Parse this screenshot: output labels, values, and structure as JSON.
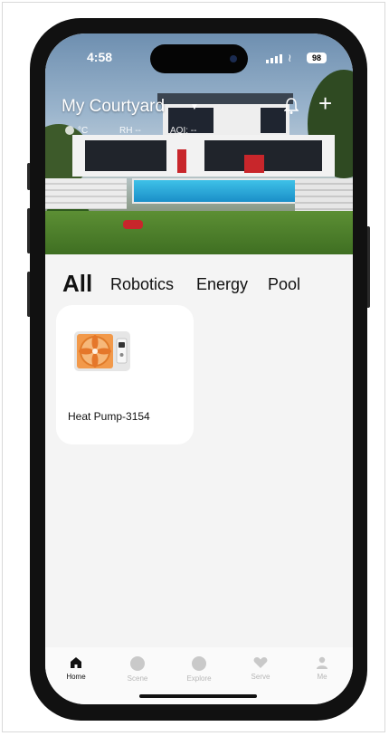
{
  "status_bar": {
    "time": "4:58",
    "battery": "98"
  },
  "header": {
    "home_name": "My Courtyard",
    "env_temp": "°C",
    "env_rh": "RH --",
    "env_aqi": "AQI: --"
  },
  "categories": {
    "active": "All",
    "items": [
      "All",
      "Robotics",
      "Energy",
      "Pool"
    ]
  },
  "devices": [
    {
      "name": "Heat Pump-3154",
      "icon": "heat-pump-icon"
    }
  ],
  "tab_bar": {
    "items": [
      {
        "label": "Home",
        "icon": "home-icon",
        "active": true
      },
      {
        "label": "Scene",
        "icon": "scene-icon",
        "active": false
      },
      {
        "label": "Explore",
        "icon": "explore-icon",
        "active": false
      },
      {
        "label": "Serve",
        "icon": "heart-icon",
        "active": false
      },
      {
        "label": "Me",
        "icon": "person-icon",
        "active": false
      }
    ]
  },
  "colors": {
    "accent": "#111111",
    "background": "#f4f4f4",
    "card": "#ffffff",
    "inactive": "#b7b7b7",
    "heat_pump_fan": "#f2994a"
  }
}
